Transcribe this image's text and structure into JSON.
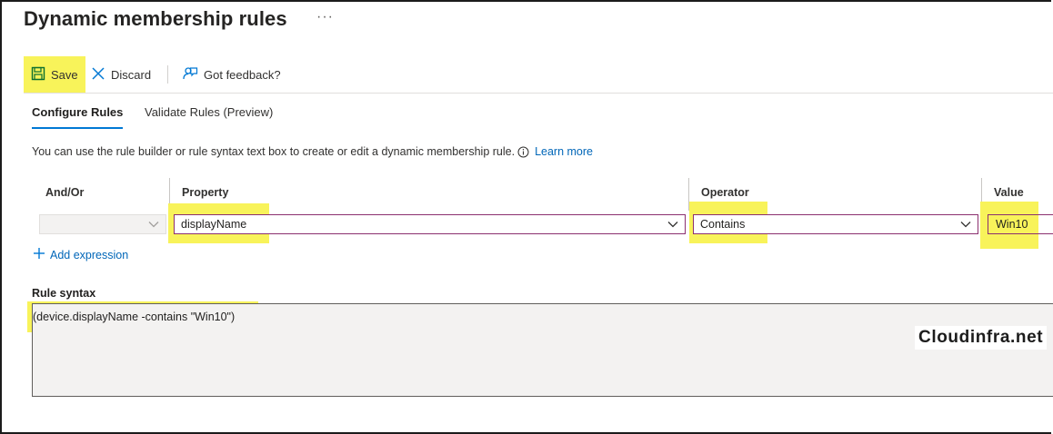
{
  "header": {
    "title": "Dynamic membership rules",
    "more_label": "···"
  },
  "toolbar": {
    "save_label": "Save",
    "discard_label": "Discard",
    "feedback_label": "Got feedback?"
  },
  "tabs": [
    {
      "label": "Configure Rules",
      "selected": true
    },
    {
      "label": "Validate Rules (Preview)",
      "selected": false
    }
  ],
  "description": {
    "text": "You can use the rule builder or rule syntax text box to create or edit a dynamic membership rule.",
    "learn_more": "Learn more"
  },
  "rule_builder": {
    "columns": [
      "And/Or",
      "Property",
      "Operator",
      "Value"
    ],
    "row": {
      "and_or": "",
      "property": "displayName",
      "operator": "Contains",
      "value": "Win10"
    },
    "add_expression_label": "Add expression"
  },
  "rule_syntax": {
    "label": "Rule syntax",
    "value": "(device.displayName -contains \"Win10\")"
  },
  "watermark": "Cloudinfra.net",
  "colors": {
    "highlight": "#f8f35a",
    "accent": "#0078d4",
    "link": "#0066b8",
    "focus_border": "#8b2f6f"
  }
}
